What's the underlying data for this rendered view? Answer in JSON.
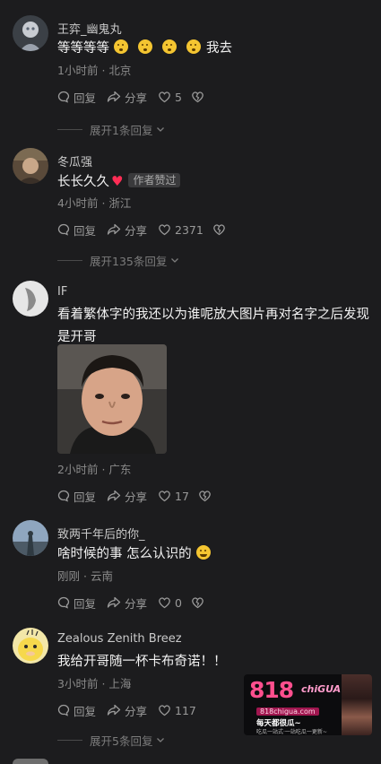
{
  "comments": [
    {
      "username": "王弈_幽鬼丸",
      "text_before": "等等等等",
      "text_after": "我去",
      "emoji_count": 4,
      "time": "1小时前",
      "location": "北京",
      "reply_label": "回复",
      "share_label": "分享",
      "like_count": "5",
      "expand_label": "展开1条回复"
    },
    {
      "username": "冬瓜强",
      "text": "长长久久",
      "heart": "♥",
      "author_badge": "作者赞过",
      "time": "4小时前",
      "location": "浙江",
      "reply_label": "回复",
      "share_label": "分享",
      "like_count": "2371",
      "expand_label": "展开135条回复"
    },
    {
      "username": "IF",
      "text": "看着繁体字的我还以为谁呢放大图片再对名字之后发现是开哥",
      "time": "2小时前",
      "location": "广东",
      "reply_label": "回复",
      "share_label": "分享",
      "like_count": "17"
    },
    {
      "username": "致两千年后的你_",
      "text": "啥时候的事 怎么认识的",
      "time": "刚刚",
      "location": "云南",
      "reply_label": "回复",
      "share_label": "分享",
      "like_count": "0"
    },
    {
      "username": "Zealous Zenith Breez",
      "text": "我给开哥随一杯卡布奇诺！！",
      "time": "3小时前",
      "location": "上海",
      "reply_label": "回复",
      "share_label": "分享",
      "like_count": "117",
      "expand_label": "展开5条回复"
    }
  ],
  "separator": "·",
  "watermark": {
    "brand": "818",
    "brand_suffix": "chiGUA",
    "site": "818chigua.com",
    "line1": "每天都很瓜~",
    "line2": "吃瓜一站式·一站吃瓜一更新~"
  },
  "colors": {
    "background": "#1c1c1e",
    "heart": "#ff2d55",
    "muted": "#8a8a8a"
  }
}
